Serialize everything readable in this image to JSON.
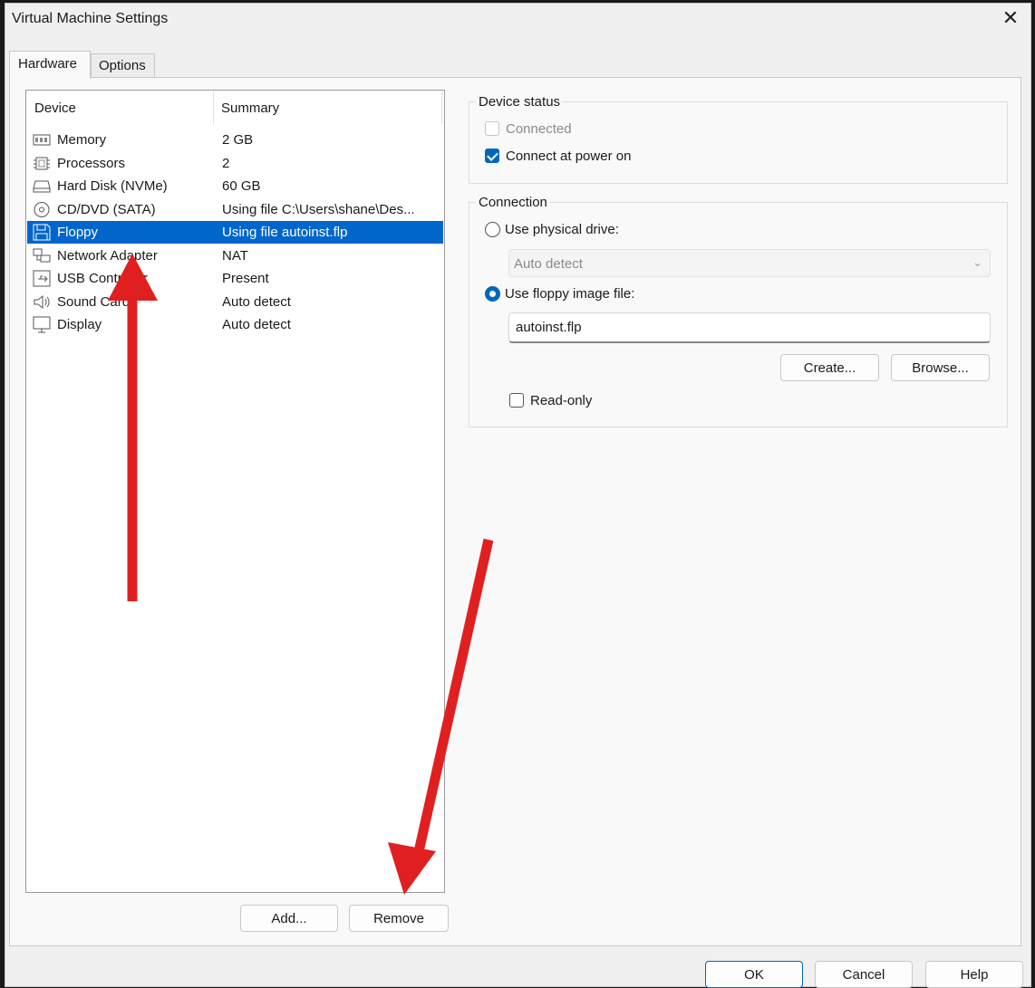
{
  "window": {
    "title": "Virtual Machine Settings",
    "close_glyph": "✕"
  },
  "tabs": [
    {
      "label": "Hardware",
      "active": true
    },
    {
      "label": "Options",
      "active": false
    }
  ],
  "device_list": {
    "columns": [
      "Device",
      "Summary"
    ],
    "rows": [
      {
        "icon": "memory-icon",
        "device": "Memory",
        "summary": "2 GB",
        "selected": false
      },
      {
        "icon": "processor-icon",
        "device": "Processors",
        "summary": "2",
        "selected": false
      },
      {
        "icon": "hard-disk-icon",
        "device": "Hard Disk (NVMe)",
        "summary": "60 GB",
        "selected": false
      },
      {
        "icon": "cd-dvd-icon",
        "device": "CD/DVD (SATA)",
        "summary": "Using file C:\\Users\\shane\\Des...",
        "selected": false
      },
      {
        "icon": "floppy-icon",
        "device": "Floppy",
        "summary": "Using file autoinst.flp",
        "selected": true
      },
      {
        "icon": "network-adapter-icon",
        "device": "Network Adapter",
        "summary": "NAT",
        "selected": false
      },
      {
        "icon": "usb-controller-icon",
        "device": "USB Controller",
        "summary": "Present",
        "selected": false
      },
      {
        "icon": "sound-card-icon",
        "device": "Sound Card",
        "summary": "Auto detect",
        "selected": false
      },
      {
        "icon": "display-icon",
        "device": "Display",
        "summary": "Auto detect",
        "selected": false
      }
    ],
    "add_label": "Add...",
    "remove_label": "Remove"
  },
  "device_status": {
    "title": "Device status",
    "connected": {
      "label": "Connected",
      "checked": false,
      "disabled": true
    },
    "connect_at_power_on": {
      "label": "Connect at power on",
      "checked": true
    }
  },
  "connection": {
    "title": "Connection",
    "use_physical_drive": {
      "label": "Use physical drive:",
      "selected": false
    },
    "physical_drive_value": "Auto detect",
    "use_floppy_image": {
      "label": "Use floppy image file:",
      "selected": true
    },
    "floppy_image_value": "autoinst.flp",
    "create_label": "Create...",
    "browse_label": "Browse...",
    "read_only": {
      "label": "Read-only",
      "checked": false
    }
  },
  "footer": {
    "ok_label": "OK",
    "cancel_label": "Cancel",
    "help_label": "Help"
  },
  "colors": {
    "accent": "#0067c0",
    "selection": "#0066cc",
    "annotation_arrow": "#e02020"
  }
}
